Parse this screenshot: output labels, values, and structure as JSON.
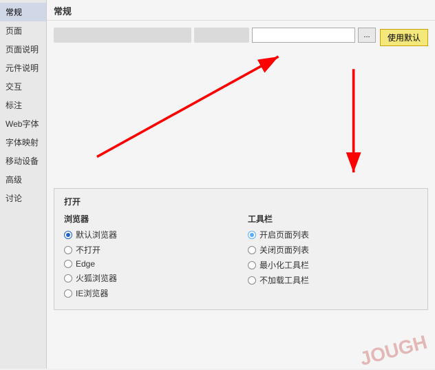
{
  "sidebar": {
    "title": "常规",
    "items": [
      {
        "label": "常规",
        "active": true
      },
      {
        "label": "页面",
        "active": false
      },
      {
        "label": "页面说明",
        "active": false
      },
      {
        "label": "元件说明",
        "active": false
      },
      {
        "label": "交互",
        "active": false
      },
      {
        "label": "标注",
        "active": false
      },
      {
        "label": "Web字体",
        "active": false
      },
      {
        "label": "字体映射",
        "active": false
      },
      {
        "label": "移动设备",
        "active": false
      },
      {
        "label": "高级",
        "active": false
      },
      {
        "label": "讨论",
        "active": false
      }
    ]
  },
  "main": {
    "title": "常规",
    "use_default_label": "使用默认",
    "browse_label": "...",
    "bottom": {
      "section_title": "打开",
      "col1_title": "浏览器",
      "col2_title": "工具栏",
      "col1_items": [
        {
          "label": "默认浏览器",
          "selected": "filled"
        },
        {
          "label": "不打开",
          "selected": "none"
        },
        {
          "label": "Edge",
          "selected": "none"
        },
        {
          "label": "火狐浏览器",
          "selected": "none"
        },
        {
          "label": "IE浏览器",
          "selected": "none"
        }
      ],
      "col2_items": [
        {
          "label": "开启页面列表",
          "selected": "light"
        },
        {
          "label": "关闭页面列表",
          "selected": "none"
        },
        {
          "label": "最小化工具栏",
          "selected": "none"
        },
        {
          "label": "不加载工具栏",
          "selected": "none"
        }
      ]
    }
  },
  "watermark": {
    "text": "JOUGH"
  }
}
